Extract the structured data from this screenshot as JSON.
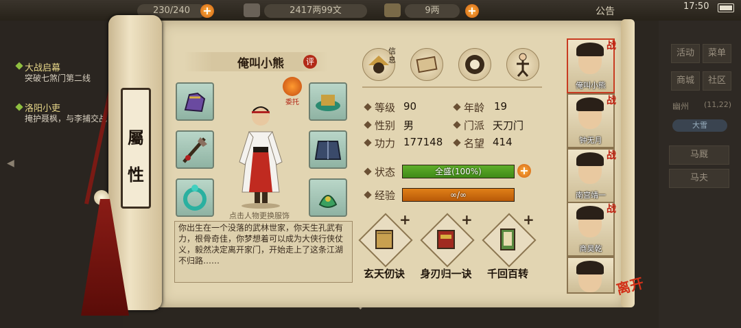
{
  "top_bar": {
    "stamina_text": "230/240",
    "money_text": "2417两99文",
    "gold_text": "9两",
    "notice_label": "公告",
    "time": "17:50"
  },
  "left_panel": {
    "quests": [
      {
        "title": "大战启幕",
        "desc": "突破七煞门第二线"
      },
      {
        "title": "洛阳小吏",
        "desc": "掩护聂枫，与李捕交战"
      }
    ]
  },
  "right_panel": {
    "buttons": [
      "活动",
      "菜单",
      "商城",
      "社区"
    ],
    "location": "幽州",
    "coords": "(11,22)",
    "weather": "大雪",
    "stable": "马厩",
    "groom": "马夫"
  },
  "scroll": {
    "title_chars": [
      "屬",
      "性"
    ]
  },
  "character": {
    "name": "俺叫小熊",
    "review_label": "评",
    "entrust_label": "委托",
    "change_hint": "点击人物更换服饰",
    "bio": "你出生在一个没落的武林世家，你天生孔武有力，根骨奇佳，你梦想着可以成为大侠行侠仗义，毅然决定离开家门，开始走上了这条江湖不归路……"
  },
  "tabs": {
    "info_label": "信息",
    "icons": [
      "info-tab-icon",
      "map-tab-icon",
      "bagua-tab-icon",
      "meridian-tab-icon"
    ]
  },
  "stats": {
    "level_label": "等级",
    "level": "90",
    "age_label": "年龄",
    "age": "19",
    "gender_label": "性别",
    "gender": "男",
    "sect_label": "门派",
    "sect": "天刀门",
    "power_label": "功力",
    "power": "177148",
    "fame_label": "名望",
    "fame": "414",
    "status_label": "状态",
    "status_text": "全盛(100%)",
    "status_fraction": 1.0,
    "exp_label": "经验",
    "exp_text": "∞/∞",
    "exp_fraction": 1.0
  },
  "skills": [
    {
      "name": "玄天仞诀",
      "plus": "+"
    },
    {
      "name": "身刃归一诀",
      "plus": "+"
    },
    {
      "name": "千回百转",
      "plus": "+"
    }
  ],
  "party": [
    {
      "name": "俺叫小熊",
      "tag": "战"
    },
    {
      "name": "钟无月",
      "tag": "战"
    },
    {
      "name": "南宫靖一",
      "tag": "战"
    },
    {
      "name": "商昊乾",
      "tag": "战"
    },
    {
      "name": "",
      "tag": ""
    }
  ],
  "leave_label": "离开",
  "colors": {
    "status_bar": "#5fae2a",
    "exp_bar": "#e07f18",
    "accent_red": "#c02010"
  }
}
